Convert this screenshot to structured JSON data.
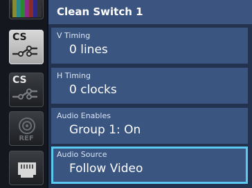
{
  "header": {
    "title": "Clean Switch 1"
  },
  "sidebar": {
    "buttons": [
      {
        "label": ""
      },
      {
        "label": "CS"
      },
      {
        "label": "CS"
      },
      {
        "label": "REF"
      },
      {
        "label": ""
      }
    ]
  },
  "fields": [
    {
      "label": "V Timing",
      "value": "0 lines"
    },
    {
      "label": "H Timing",
      "value": "0 clocks"
    },
    {
      "label": "Audio Enables",
      "value": "Group 1: On"
    },
    {
      "label": "Audio Source",
      "value": "Follow Video"
    }
  ],
  "colors": {
    "selection_border": "#5ac8f0",
    "field_bg": "#3a5580",
    "header_bg": "#3c5580"
  }
}
